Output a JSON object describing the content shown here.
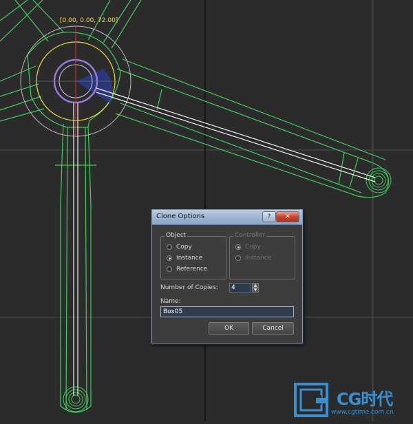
{
  "viewport": {
    "coordinate_readout": "[0.00, 0.00, 72.00]"
  },
  "dialog": {
    "title": "Clone Options",
    "help_glyph": "?",
    "close_glyph": "✕",
    "object_group": {
      "title": "Object",
      "options": [
        "Copy",
        "Instance",
        "Reference"
      ],
      "selected": "Instance"
    },
    "controller_group": {
      "title": "Controller",
      "options": [
        "Copy",
        "Instance"
      ],
      "selected": "Copy",
      "enabled": false
    },
    "number_of_copies": {
      "label": "Number of Copies:",
      "value": "4"
    },
    "name": {
      "label": "Name:",
      "value": "Box05"
    },
    "ok_label": "OK",
    "cancel_label": "Cancel"
  },
  "watermark": {
    "brand": "CG时代",
    "url": "www.cgtime.com.cn"
  },
  "colors": {
    "viewport_bg": "#2b2b2b",
    "wireframe": "#3fcf5a",
    "selected_wire": "#ffffff",
    "gizmo_yellow": "#e8e23a",
    "gizmo_circle": "#c8c8c8",
    "brand_blue": "#3a8fd0"
  },
  "icons": {
    "help": "question-icon",
    "close": "close-icon",
    "spin_up": "chevron-up-icon",
    "spin_down": "chevron-down-icon"
  }
}
